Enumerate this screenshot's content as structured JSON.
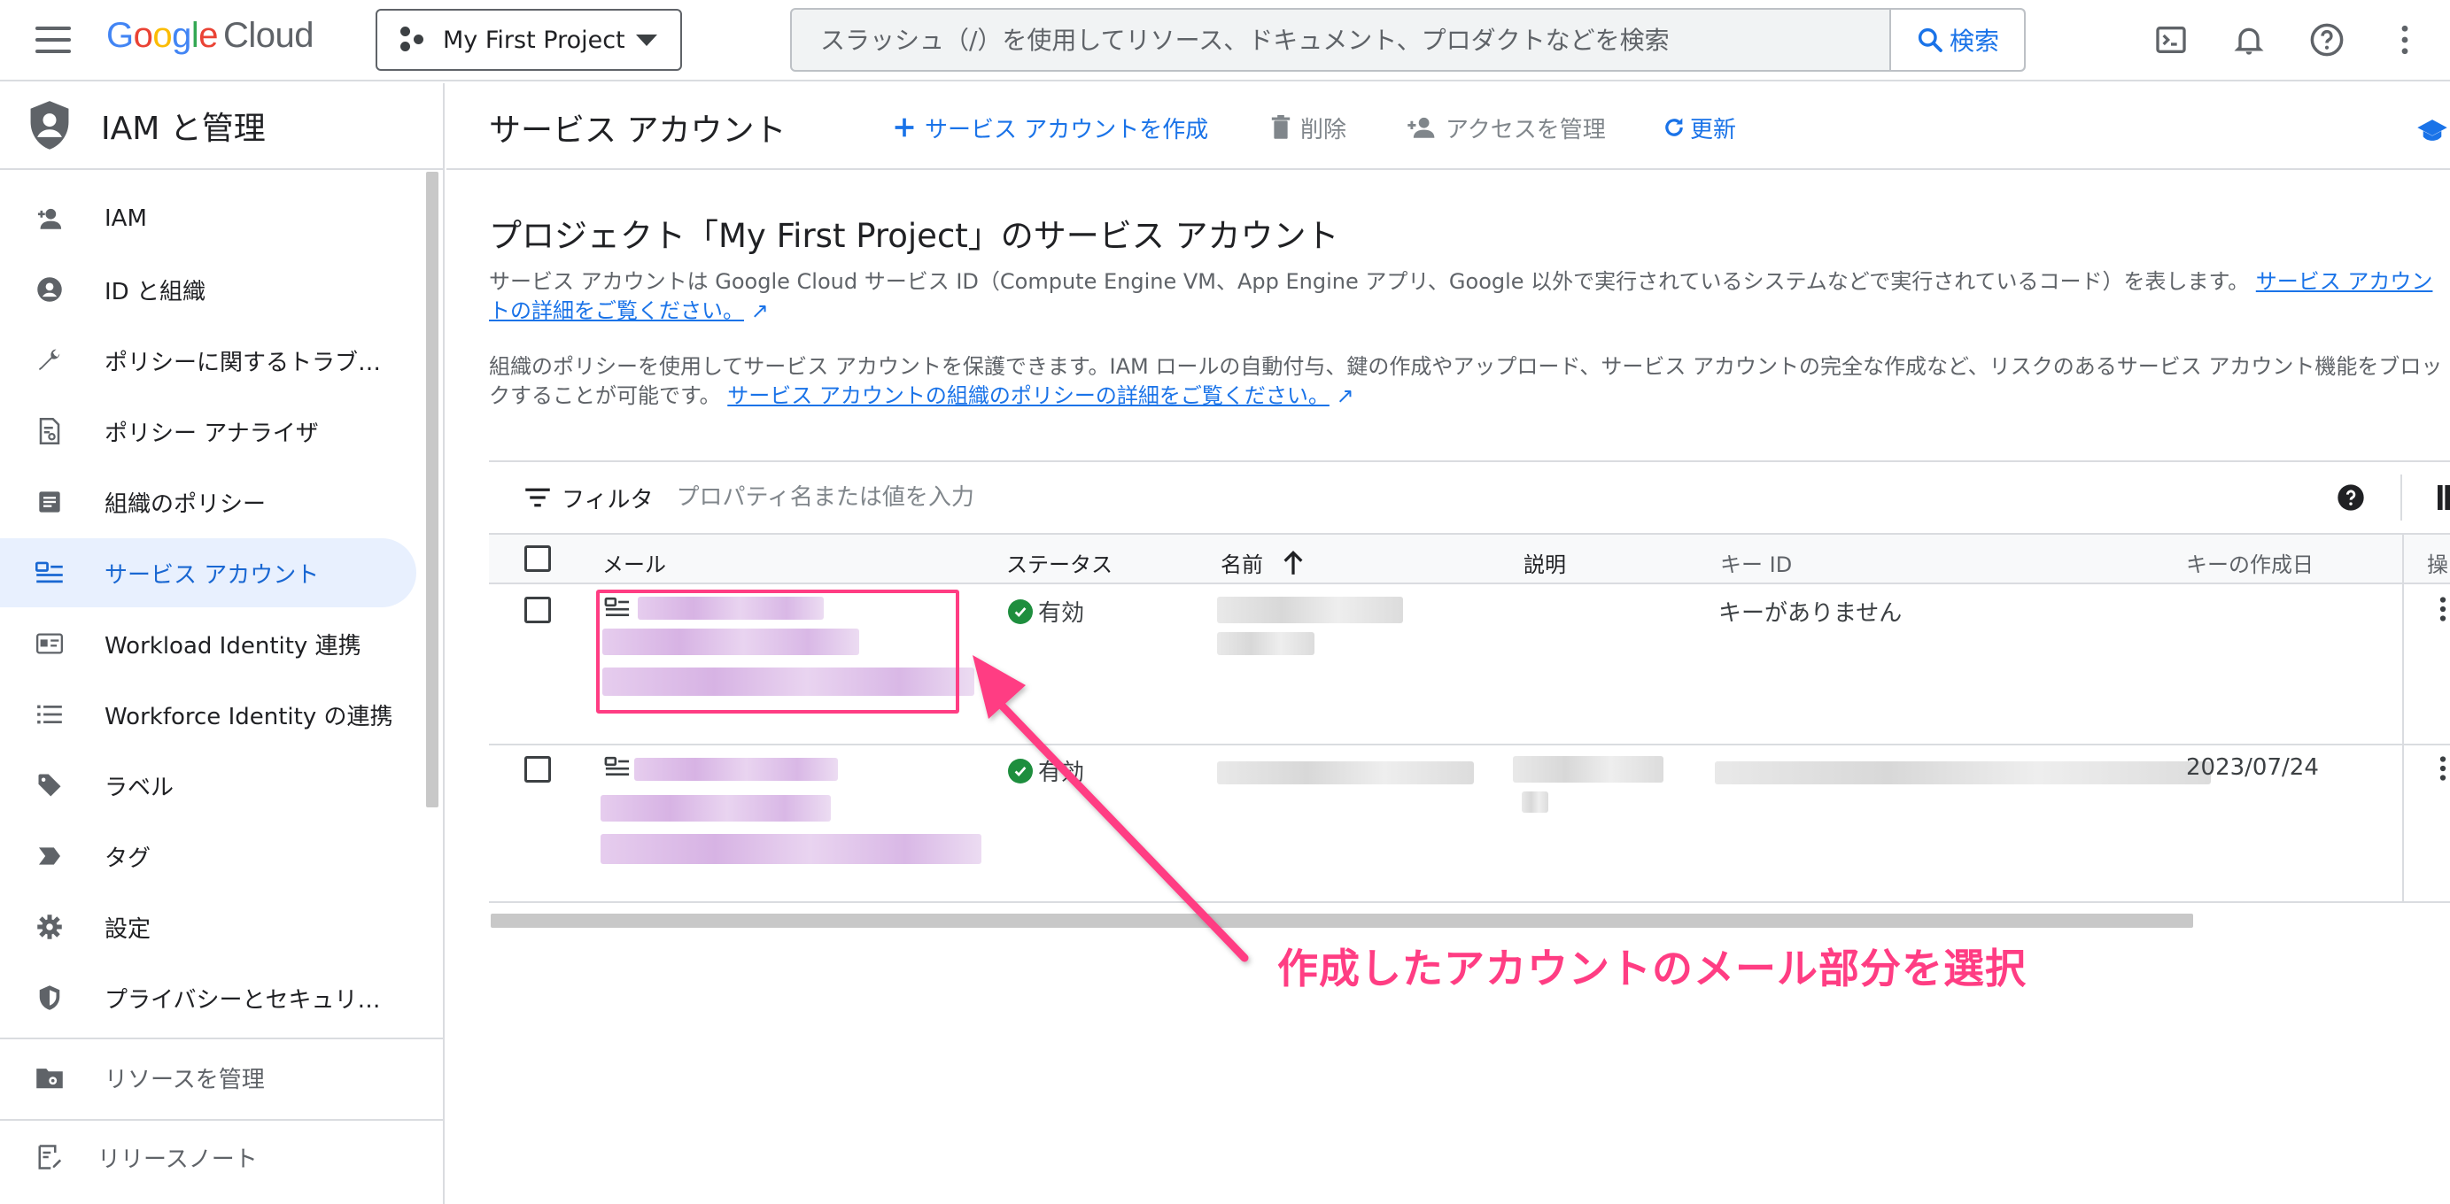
{
  "topbar": {
    "logo_google": "Google",
    "logo_cloud": "Cloud",
    "project_name": "My First Project",
    "search_placeholder": "スラッシュ（/）を使用してリソース、ドキュメント、プロダクトなどを検索",
    "search_button": "検索"
  },
  "sidebar": {
    "title": "IAM と管理",
    "items": [
      {
        "label": "IAM",
        "icon": "person-add-icon"
      },
      {
        "label": "ID と組織",
        "icon": "account-circle-icon"
      },
      {
        "label": "ポリシーに関するトラブ…",
        "icon": "wrench-icon"
      },
      {
        "label": "ポリシー アナライザ",
        "icon": "document-search-icon"
      },
      {
        "label": "組織のポリシー",
        "icon": "article-icon"
      },
      {
        "label": "サービス アカウント",
        "icon": "service-account-icon",
        "active": true
      },
      {
        "label": "Workload Identity 連携",
        "icon": "id-card-icon"
      },
      {
        "label": "Workforce Identity の連携",
        "icon": "list-icon"
      },
      {
        "label": "ラベル",
        "icon": "tag-icon"
      },
      {
        "label": "タグ",
        "icon": "chevron-tag-icon"
      },
      {
        "label": "設定",
        "icon": "gear-icon"
      },
      {
        "label": "プライバシーとセキュリ…",
        "icon": "shield-icon"
      }
    ],
    "manage_resources": "リソースを管理",
    "release_notes": "リリースノート"
  },
  "header": {
    "title": "サービス アカウント",
    "create": "サービス アカウントを作成",
    "delete": "削除",
    "manage_access": "アクセスを管理",
    "refresh": "更新"
  },
  "main": {
    "section_title": "プロジェクト「My First Project」のサービス アカウント",
    "desc1": "サービス アカウントは Google Cloud サービス ID（Compute Engine VM、App Engine アプリ、Google 以外で実行されているシステムなどで実行されているコード）を表します。",
    "desc1_link": "サービス アカウントの詳細をご覧ください。",
    "desc2": "組織のポリシーを使用してサービス アカウントを保護できます。IAM ロールの自動付与、鍵の作成やアップロード、サービス アカウントの完全な作成など、リスクのあるサービス アカウント機能をブロックすることが可能です。",
    "desc2_link": "サービス アカウントの組織のポリシーの詳細をご覧ください。"
  },
  "table": {
    "filter_label": "フィルタ",
    "filter_placeholder": "プロパティ名または値を入力",
    "columns": [
      "メール",
      "ステータス",
      "名前",
      "説明",
      "キー ID",
      "キーの作成日",
      "操"
    ],
    "rows": [
      {
        "status": "有効",
        "key_id": "キーがありません",
        "key_date": ""
      },
      {
        "status": "有効",
        "key_id": "",
        "key_date": "2023/07/24"
      }
    ]
  },
  "annotation": {
    "text": "作成したアカウントのメール部分を選択",
    "color": "#ff3d83"
  },
  "colors": {
    "accent": "#1a73e8",
    "active_bg": "#e8f0fe",
    "status_ok": "#1e8e3e"
  }
}
